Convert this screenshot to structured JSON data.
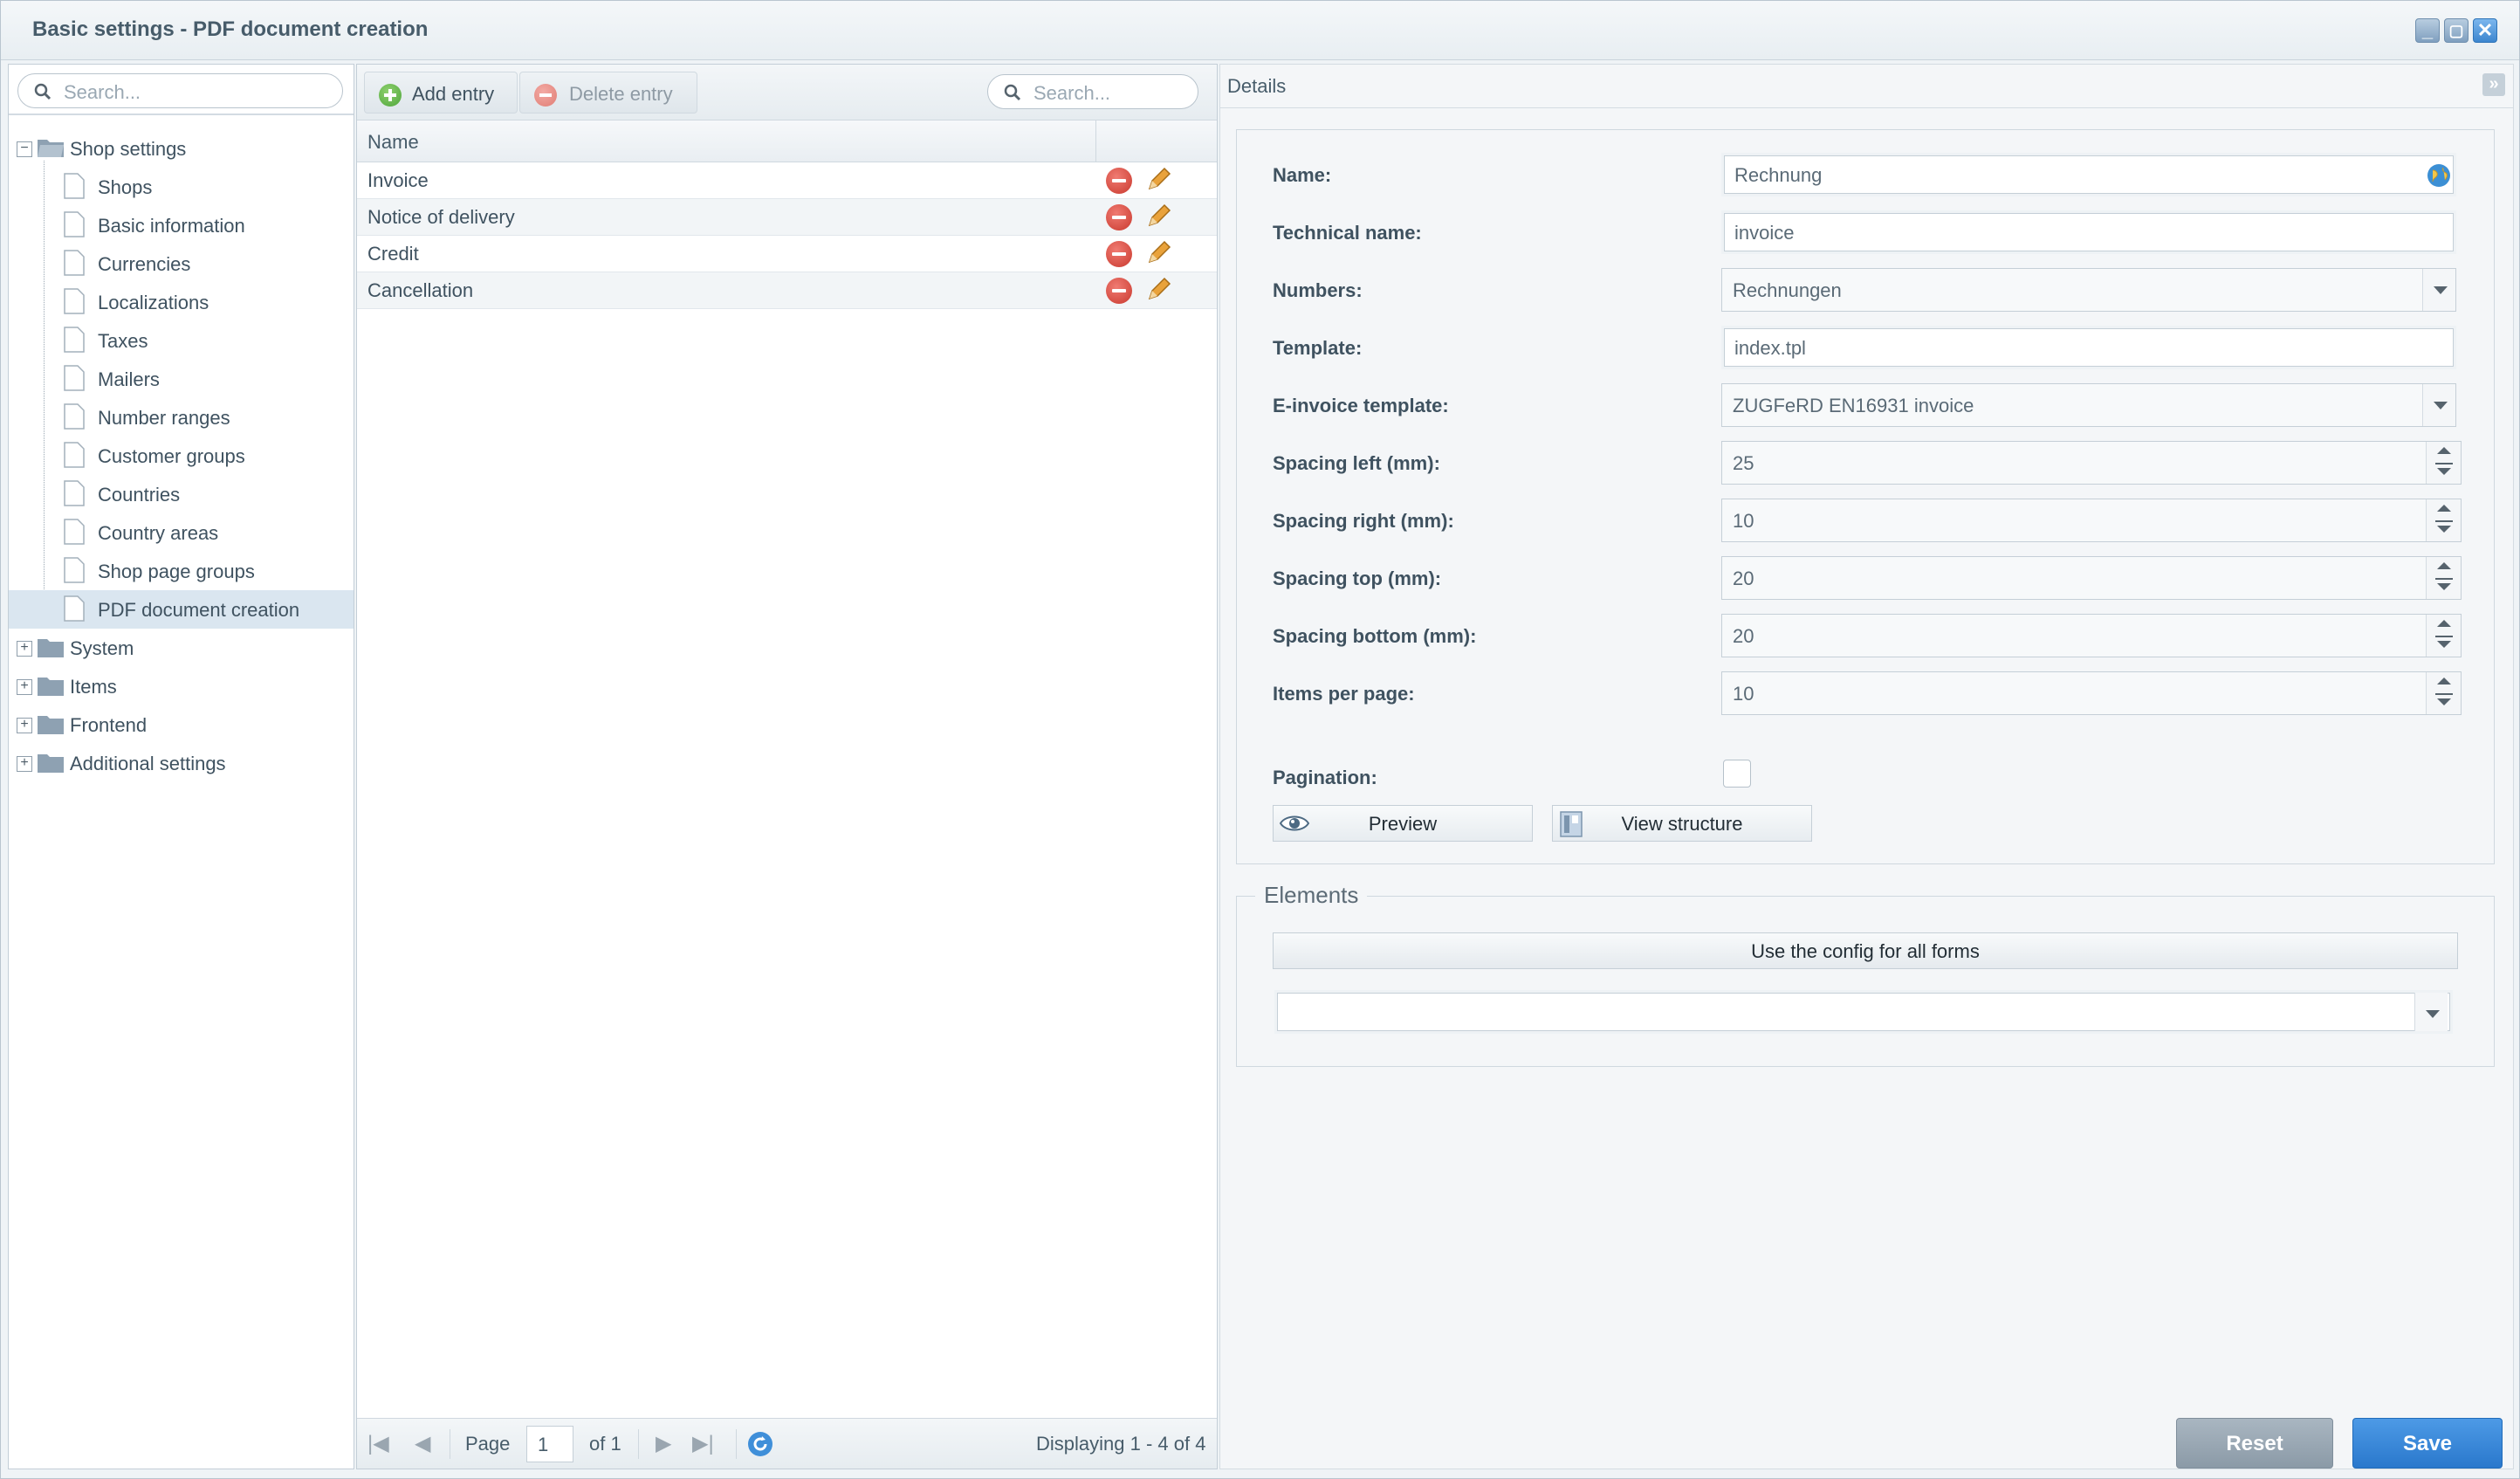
{
  "window": {
    "title": "Basic settings - PDF document creation",
    "controls": [
      "minimize",
      "maximize",
      "close"
    ]
  },
  "tree": {
    "search_placeholder": "Search...",
    "root": "Shop settings",
    "items": [
      "Shops",
      "Basic information",
      "Currencies",
      "Localizations",
      "Taxes",
      "Mailers",
      "Number ranges",
      "Customer groups",
      "Countries",
      "Country areas",
      "Shop page groups",
      "PDF document creation"
    ],
    "selected": "PDF document creation",
    "collapsed_groups": [
      "System",
      "Items",
      "Frontend",
      "Additional settings"
    ]
  },
  "grid": {
    "toolbar": {
      "add_label": "Add entry",
      "delete_label": "Delete entry",
      "search_placeholder": "Search..."
    },
    "column_name": "Name",
    "rows": [
      "Invoice",
      "Notice of delivery",
      "Credit",
      "Cancellation"
    ],
    "pager": {
      "page_label": "Page",
      "page_value": "1",
      "of_label": "of 1",
      "displaying": "Displaying 1 - 4 of 4"
    }
  },
  "details": {
    "header": "Details",
    "fields": {
      "name": {
        "label": "Name:",
        "value": "Rechnung"
      },
      "technical_name": {
        "label": "Technical name:",
        "value": "invoice"
      },
      "numbers": {
        "label": "Numbers:",
        "value": "Rechnungen"
      },
      "template": {
        "label": "Template:",
        "value": "index.tpl"
      },
      "e_invoice": {
        "label": "E-invoice template:",
        "value": "ZUGFeRD EN16931 invoice"
      },
      "spacing_left": {
        "label": "Spacing left (mm):",
        "value": "25"
      },
      "spacing_right": {
        "label": "Spacing right (mm):",
        "value": "10"
      },
      "spacing_top": {
        "label": "Spacing top (mm):",
        "value": "20"
      },
      "spacing_bottom": {
        "label": "Spacing bottom (mm):",
        "value": "20"
      },
      "items_per_page": {
        "label": "Items per page:",
        "value": "10"
      },
      "pagination": {
        "label": "Pagination:",
        "checked": false
      }
    },
    "preview_label": "Preview",
    "view_structure_label": "View structure",
    "elements": {
      "legend": "Elements",
      "use_config_label": "Use the config for all forms",
      "select_value": ""
    },
    "reset_label": "Reset",
    "save_label": "Save"
  },
  "colors": {
    "accent_blue": "#2a78cc",
    "delete_red": "#c9392e",
    "add_green": "#4ea53a",
    "selected_row": "#dae6f0"
  }
}
